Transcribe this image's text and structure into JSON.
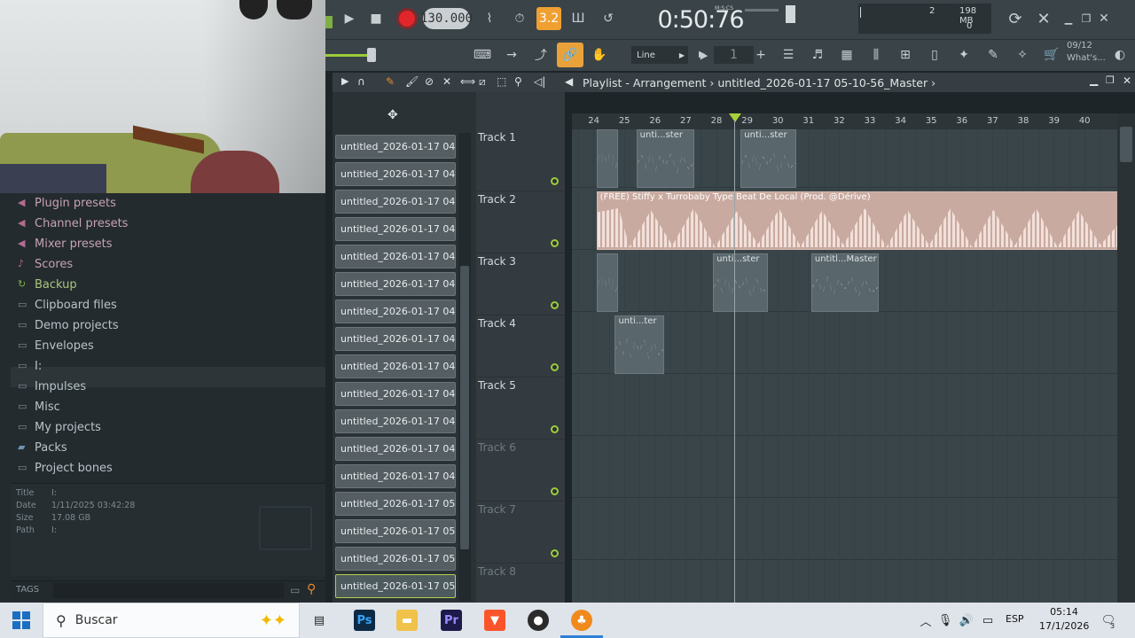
{
  "transport": {
    "tempo": "130.000",
    "time": "0:50:76",
    "time_label": "M:S:CS"
  },
  "cpu": {
    "poly": "2",
    "mem": "198 MB",
    "zero": "0"
  },
  "snap": {
    "value": "Line"
  },
  "pattern": {
    "value": "1"
  },
  "hint": {
    "date": "09/12",
    "text": "What's..."
  },
  "browser": {
    "items": [
      {
        "label": "Plugin presets",
        "icon": "plugin-preset-icon",
        "style": "pink"
      },
      {
        "label": "Channel presets",
        "icon": "channel-preset-icon",
        "style": "pink"
      },
      {
        "label": "Mixer presets",
        "icon": "mixer-preset-icon",
        "style": "pink"
      },
      {
        "label": "Scores",
        "icon": "note-icon",
        "style": "pink"
      },
      {
        "label": "Backup",
        "icon": "backup-icon",
        "style": "green"
      },
      {
        "label": "Clipboard files",
        "icon": "folder-icon",
        "style": ""
      },
      {
        "label": "Demo projects",
        "icon": "folder-icon",
        "style": ""
      },
      {
        "label": "Envelopes",
        "icon": "folder-icon",
        "style": ""
      },
      {
        "label": "I:",
        "icon": "folder-icon",
        "style": ""
      },
      {
        "label": "Impulses",
        "icon": "folder-icon",
        "style": ""
      },
      {
        "label": "Misc",
        "icon": "folder-icon",
        "style": ""
      },
      {
        "label": "My projects",
        "icon": "folder-icon",
        "style": ""
      },
      {
        "label": "Packs",
        "icon": "packs-icon",
        "style": "blue"
      },
      {
        "label": "Project bones",
        "icon": "folder-icon",
        "style": ""
      }
    ],
    "info": {
      "title_k": "Title",
      "title_v": "I:",
      "date_k": "Date",
      "date_v": "1/11/2025 03:42:28",
      "size_k": "Size",
      "size_v": "17.08 GB",
      "path_k": "Path",
      "path_v": "I:"
    },
    "tags_label": "TAGS"
  },
  "playlist": {
    "title": "Playlist - Arrangement",
    "project": "untitled_2026-01-17 05-10-56_Master",
    "clips": [
      "untitled_2026-01-17 04-...",
      "untitled_2026-01-17 04-...",
      "untitled_2026-01-17 04-...",
      "untitled_2026-01-17 04-...",
      "untitled_2026-01-17 04-...",
      "untitled_2026-01-17 04-...",
      "untitled_2026-01-17 04-...",
      "untitled_2026-01-17 04-...",
      "untitled_2026-01-17 04-...",
      "untitled_2026-01-17 04-...",
      "untitled_2026-01-17 04-...",
      "untitled_2026-01-17 04-...",
      "untitled_2026-01-17 04-...",
      "untitled_2026-01-17 05-...",
      "untitled_2026-01-17 05-...",
      "untitled_2026-01-17 05-...",
      "untitled_2026-01-17 05-..."
    ],
    "ruler": [
      "24",
      "25",
      "26",
      "27",
      "28",
      "29",
      "30",
      "31",
      "32",
      "33",
      "34",
      "35",
      "36",
      "37",
      "38",
      "39",
      "40"
    ],
    "tracks": [
      {
        "name": "Track 1",
        "dim": false
      },
      {
        "name": "Track 2",
        "dim": false
      },
      {
        "name": "Track 3",
        "dim": false
      },
      {
        "name": "Track 4",
        "dim": false
      },
      {
        "name": "Track 5",
        "dim": false
      },
      {
        "name": "Track 6",
        "dim": true
      },
      {
        "name": "Track 7",
        "dim": true
      },
      {
        "name": "Track 8",
        "dim": true
      }
    ],
    "arrangement": [
      {
        "track": 0,
        "label": "",
        "bar": 24.1,
        "len": 0.7
      },
      {
        "track": 0,
        "label": "unti...ster",
        "bar": 25.4,
        "len": 1.9
      },
      {
        "track": 0,
        "label": "unti...ster",
        "bar": 28.8,
        "len": 1.8
      },
      {
        "track": 1,
        "label": "(FREE) Stiffy x Turrobaby Type Beat  De Local (Prod. @Dérive)",
        "bar": 24.1,
        "len": 17.5,
        "big": true
      },
      {
        "track": 2,
        "label": "",
        "bar": 24.1,
        "len": 0.7
      },
      {
        "track": 2,
        "label": "unti...ster",
        "bar": 27.9,
        "len": 1.8
      },
      {
        "track": 2,
        "label": "untitl...Master",
        "bar": 31.1,
        "len": 2.2
      },
      {
        "track": 3,
        "label": "unti...ter",
        "bar": 24.7,
        "len": 1.6
      }
    ]
  },
  "taskbar": {
    "search": "Buscar",
    "lang": "ESP",
    "time": "05:14",
    "date": "17/1/2026",
    "notif": "3"
  }
}
